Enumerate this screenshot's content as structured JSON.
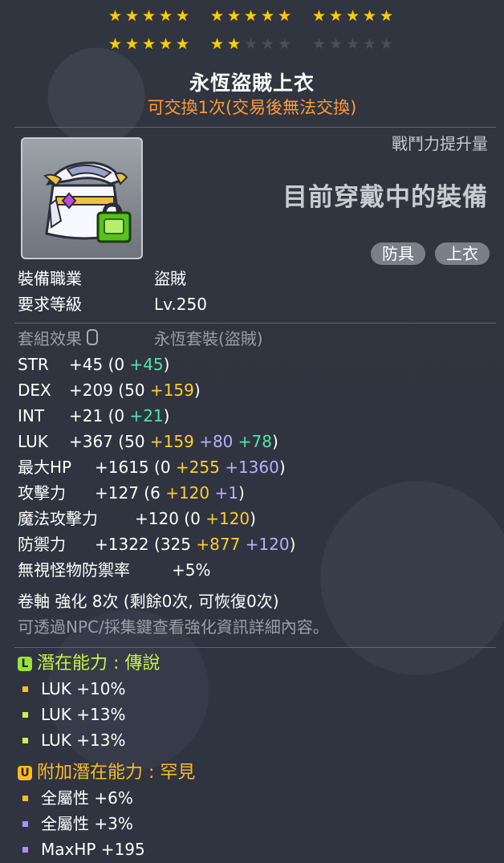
{
  "stars": {
    "row1": [
      5,
      5,
      5
    ],
    "row2_filled": [
      5,
      2,
      0
    ],
    "group_size": 5
  },
  "item": {
    "name": "永恆盜賊上衣",
    "trade_note": "可交換1次(交易後無法交換)"
  },
  "combat": {
    "label": "戰鬥力提升量",
    "wearing": "目前穿戴中的裝備"
  },
  "tags": [
    "防具",
    "上衣"
  ],
  "requirements": [
    {
      "label": "裝備職業",
      "value": "盜賊"
    },
    {
      "label": "要求等級",
      "value": "Lv.250"
    }
  ],
  "set_effect": {
    "label": "套組效果",
    "value": "永恆套裝(盜賊)"
  },
  "stats": [
    {
      "label": "STR",
      "parts": [
        {
          "t": "+45 (0 ",
          "c": ""
        },
        {
          "t": "+45",
          "c": "c-g"
        },
        {
          "t": ")",
          "c": ""
        }
      ]
    },
    {
      "label": "DEX",
      "parts": [
        {
          "t": "+209 (50 ",
          "c": ""
        },
        {
          "t": "+159",
          "c": "c-y"
        },
        {
          "t": ")",
          "c": ""
        }
      ]
    },
    {
      "label": "INT",
      "parts": [
        {
          "t": "+21 (0 ",
          "c": ""
        },
        {
          "t": "+21",
          "c": "c-g"
        },
        {
          "t": ")",
          "c": ""
        }
      ]
    },
    {
      "label": "LUK",
      "parts": [
        {
          "t": "+367 (50 ",
          "c": ""
        },
        {
          "t": "+159",
          "c": "c-y"
        },
        {
          "t": " ",
          "c": ""
        },
        {
          "t": "+80",
          "c": "c-p"
        },
        {
          "t": " ",
          "c": ""
        },
        {
          "t": "+78",
          "c": "c-g"
        },
        {
          "t": ")",
          "c": ""
        }
      ]
    },
    {
      "label": "最大HP",
      "parts": [
        {
          "t": "+1615 (0 ",
          "c": ""
        },
        {
          "t": "+255",
          "c": "c-y"
        },
        {
          "t": " ",
          "c": ""
        },
        {
          "t": "+1360",
          "c": "c-p"
        },
        {
          "t": ")",
          "c": ""
        }
      ]
    },
    {
      "label": "攻擊力",
      "parts": [
        {
          "t": "+127 (6 ",
          "c": ""
        },
        {
          "t": "+120",
          "c": "c-y"
        },
        {
          "t": " ",
          "c": ""
        },
        {
          "t": "+1",
          "c": "c-p"
        },
        {
          "t": ")",
          "c": ""
        }
      ]
    },
    {
      "label": "魔法攻擊力",
      "parts": [
        {
          "t": "+120 (0 ",
          "c": ""
        },
        {
          "t": "+120",
          "c": "c-y"
        },
        {
          "t": ")",
          "c": ""
        }
      ]
    },
    {
      "label": "防禦力",
      "parts": [
        {
          "t": "+1322 (325 ",
          "c": ""
        },
        {
          "t": "+877",
          "c": "c-y"
        },
        {
          "t": " ",
          "c": ""
        },
        {
          "t": "+120",
          "c": "c-p"
        },
        {
          "t": ")",
          "c": ""
        }
      ]
    },
    {
      "label": "無視怪物防禦率",
      "parts": [
        {
          "t": "+5%",
          "c": ""
        }
      ]
    }
  ],
  "scroll": {
    "upgrade": "卷軸 強化 8次 (剩餘0次, 可恢復0次)",
    "hint": "可透過NPC/採集鍵查看強化資訊詳細內容。"
  },
  "potential": {
    "badge": "L",
    "title": "潛在能力 : 傳說",
    "title_color": "#c6f34e",
    "lines": [
      {
        "text": "LUK +10%",
        "bullet_color": "#ffbb22"
      },
      {
        "text": "LUK +13%",
        "bullet_color": "#c6f34e"
      },
      {
        "text": "LUK +13%",
        "bullet_color": "#c6f34e"
      }
    ]
  },
  "additional": {
    "badge": "U",
    "title": "附加潛在能力 : 罕見",
    "title_color": "#ffbb22",
    "lines": [
      {
        "text": "全屬性 +6%",
        "bullet_color": "#ffbb22"
      },
      {
        "text": "全屬性 +3%",
        "bullet_color": "#b08cff"
      },
      {
        "text": "MaxHP +195",
        "bullet_color": "#b08cff"
      }
    ]
  }
}
